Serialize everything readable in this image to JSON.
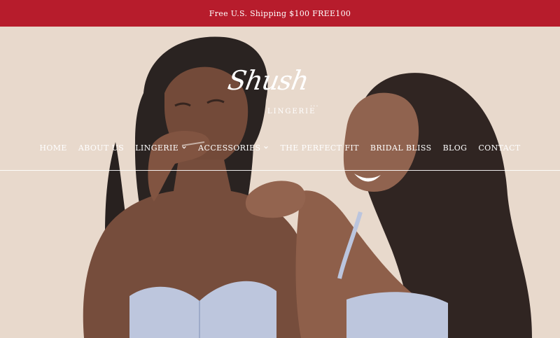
{
  "promo": {
    "text": "Free U.S. Shipping $100 FREE100"
  },
  "logo": {
    "script": "Shush",
    "dots": "...",
    "subtitle": "LINGERIE"
  },
  "nav": {
    "items": [
      {
        "label": "HOME",
        "has_dropdown": false
      },
      {
        "label": "ABOUT US",
        "has_dropdown": false
      },
      {
        "label": "LINGERIE",
        "has_dropdown": true
      },
      {
        "label": "ACCESSORIES",
        "has_dropdown": true
      },
      {
        "label": "THE PERFECT FIT",
        "has_dropdown": false
      },
      {
        "label": "BRIDAL BLISS",
        "has_dropdown": false
      },
      {
        "label": "BLOG",
        "has_dropdown": false
      },
      {
        "label": "CONTACT",
        "has_dropdown": false
      }
    ]
  },
  "colors": {
    "promo_bg": "#b71c2c",
    "text": "#ffffff",
    "hero_bg": "#e7d8cb"
  }
}
